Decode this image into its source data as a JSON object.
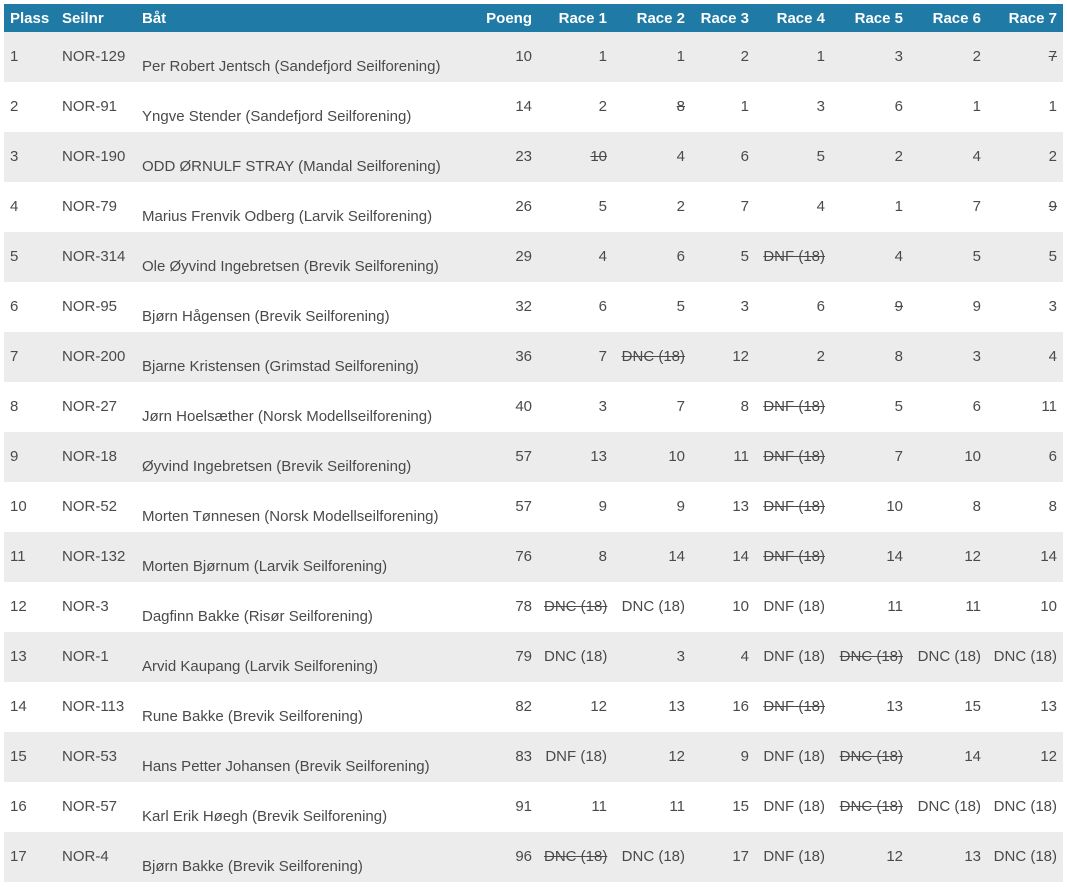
{
  "table": {
    "headers": {
      "plass": "Plass",
      "seilnr": "Seilnr",
      "bat": "Båt",
      "poeng": "Poeng",
      "races": [
        "Race 1",
        "Race 2",
        "Race 3",
        "Race 4",
        "Race 5",
        "Race 6",
        "Race 7"
      ]
    },
    "rows": [
      {
        "plass": "1",
        "seilnr": "NOR-129",
        "bat": "Per Robert Jentsch (Sandefjord Seilforening)",
        "poeng": "10",
        "races": [
          {
            "v": "1",
            "d": false
          },
          {
            "v": "1",
            "d": false
          },
          {
            "v": "2",
            "d": false
          },
          {
            "v": "1",
            "d": false
          },
          {
            "v": "3",
            "d": false
          },
          {
            "v": "2",
            "d": false
          },
          {
            "v": "7",
            "d": true
          }
        ]
      },
      {
        "plass": "2",
        "seilnr": "NOR-91",
        "bat": "Yngve Stender (Sandefjord Seilforening)",
        "poeng": "14",
        "races": [
          {
            "v": "2",
            "d": false
          },
          {
            "v": "8",
            "d": true
          },
          {
            "v": "1",
            "d": false
          },
          {
            "v": "3",
            "d": false
          },
          {
            "v": "6",
            "d": false
          },
          {
            "v": "1",
            "d": false
          },
          {
            "v": "1",
            "d": false
          }
        ]
      },
      {
        "plass": "3",
        "seilnr": "NOR-190",
        "bat": "ODD ØRNULF STRAY (Mandal Seilforening)",
        "poeng": "23",
        "races": [
          {
            "v": "10",
            "d": true
          },
          {
            "v": "4",
            "d": false
          },
          {
            "v": "6",
            "d": false
          },
          {
            "v": "5",
            "d": false
          },
          {
            "v": "2",
            "d": false
          },
          {
            "v": "4",
            "d": false
          },
          {
            "v": "2",
            "d": false
          }
        ]
      },
      {
        "plass": "4",
        "seilnr": "NOR-79",
        "bat": "Marius Frenvik Odberg (Larvik Seilforening)",
        "poeng": "26",
        "races": [
          {
            "v": "5",
            "d": false
          },
          {
            "v": "2",
            "d": false
          },
          {
            "v": "7",
            "d": false
          },
          {
            "v": "4",
            "d": false
          },
          {
            "v": "1",
            "d": false
          },
          {
            "v": "7",
            "d": false
          },
          {
            "v": "9",
            "d": true
          }
        ]
      },
      {
        "plass": "5",
        "seilnr": "NOR-314",
        "bat": "Ole Øyvind Ingebretsen (Brevik Seilforening)",
        "poeng": "29",
        "races": [
          {
            "v": "4",
            "d": false
          },
          {
            "v": "6",
            "d": false
          },
          {
            "v": "5",
            "d": false
          },
          {
            "v": "DNF (18)",
            "d": true
          },
          {
            "v": "4",
            "d": false
          },
          {
            "v": "5",
            "d": false
          },
          {
            "v": "5",
            "d": false
          }
        ]
      },
      {
        "plass": "6",
        "seilnr": "NOR-95",
        "bat": "Bjørn Hågensen (Brevik Seilforening)",
        "poeng": "32",
        "races": [
          {
            "v": "6",
            "d": false
          },
          {
            "v": "5",
            "d": false
          },
          {
            "v": "3",
            "d": false
          },
          {
            "v": "6",
            "d": false
          },
          {
            "v": "9",
            "d": true
          },
          {
            "v": "9",
            "d": false
          },
          {
            "v": "3",
            "d": false
          }
        ]
      },
      {
        "plass": "7",
        "seilnr": "NOR-200",
        "bat": "Bjarne Kristensen (Grimstad Seilforening)",
        "poeng": "36",
        "races": [
          {
            "v": "7",
            "d": false
          },
          {
            "v": "DNC (18)",
            "d": true
          },
          {
            "v": "12",
            "d": false
          },
          {
            "v": "2",
            "d": false
          },
          {
            "v": "8",
            "d": false
          },
          {
            "v": "3",
            "d": false
          },
          {
            "v": "4",
            "d": false
          }
        ]
      },
      {
        "plass": "8",
        "seilnr": "NOR-27",
        "bat": "Jørn Hoelsæther (Norsk Modellseilforening)",
        "poeng": "40",
        "races": [
          {
            "v": "3",
            "d": false
          },
          {
            "v": "7",
            "d": false
          },
          {
            "v": "8",
            "d": false
          },
          {
            "v": "DNF (18)",
            "d": true
          },
          {
            "v": "5",
            "d": false
          },
          {
            "v": "6",
            "d": false
          },
          {
            "v": "11",
            "d": false
          }
        ]
      },
      {
        "plass": "9",
        "seilnr": "NOR-18",
        "bat": "Øyvind Ingebretsen (Brevik Seilforening)",
        "poeng": "57",
        "races": [
          {
            "v": "13",
            "d": false
          },
          {
            "v": "10",
            "d": false
          },
          {
            "v": "11",
            "d": false
          },
          {
            "v": "DNF (18)",
            "d": true
          },
          {
            "v": "7",
            "d": false
          },
          {
            "v": "10",
            "d": false
          },
          {
            "v": "6",
            "d": false
          }
        ]
      },
      {
        "plass": "10",
        "seilnr": "NOR-52",
        "bat": "Morten Tønnesen (Norsk Modellseilforening)",
        "poeng": "57",
        "races": [
          {
            "v": "9",
            "d": false
          },
          {
            "v": "9",
            "d": false
          },
          {
            "v": "13",
            "d": false
          },
          {
            "v": "DNF (18)",
            "d": true
          },
          {
            "v": "10",
            "d": false
          },
          {
            "v": "8",
            "d": false
          },
          {
            "v": "8",
            "d": false
          }
        ]
      },
      {
        "plass": "11",
        "seilnr": "NOR-132",
        "bat": "Morten Bjørnum (Larvik Seilforening)",
        "poeng": "76",
        "races": [
          {
            "v": "8",
            "d": false
          },
          {
            "v": "14",
            "d": false
          },
          {
            "v": "14",
            "d": false
          },
          {
            "v": "DNF (18)",
            "d": true
          },
          {
            "v": "14",
            "d": false
          },
          {
            "v": "12",
            "d": false
          },
          {
            "v": "14",
            "d": false
          }
        ]
      },
      {
        "plass": "12",
        "seilnr": "NOR-3",
        "bat": "Dagfinn Bakke (Risør Seilforening)",
        "poeng": "78",
        "races": [
          {
            "v": "DNC (18)",
            "d": true
          },
          {
            "v": "DNC (18)",
            "d": false
          },
          {
            "v": "10",
            "d": false
          },
          {
            "v": "DNF (18)",
            "d": false
          },
          {
            "v": "11",
            "d": false
          },
          {
            "v": "11",
            "d": false
          },
          {
            "v": "10",
            "d": false
          }
        ]
      },
      {
        "plass": "13",
        "seilnr": "NOR-1",
        "bat": "Arvid Kaupang (Larvik Seilforening)",
        "poeng": "79",
        "races": [
          {
            "v": "DNC (18)",
            "d": false
          },
          {
            "v": "3",
            "d": false
          },
          {
            "v": "4",
            "d": false
          },
          {
            "v": "DNF (18)",
            "d": false
          },
          {
            "v": "DNC (18)",
            "d": true
          },
          {
            "v": "DNC (18)",
            "d": false
          },
          {
            "v": "DNC (18)",
            "d": false
          }
        ]
      },
      {
        "plass": "14",
        "seilnr": "NOR-113",
        "bat": "Rune Bakke (Brevik Seilforening)",
        "poeng": "82",
        "races": [
          {
            "v": "12",
            "d": false
          },
          {
            "v": "13",
            "d": false
          },
          {
            "v": "16",
            "d": false
          },
          {
            "v": "DNF (18)",
            "d": true
          },
          {
            "v": "13",
            "d": false
          },
          {
            "v": "15",
            "d": false
          },
          {
            "v": "13",
            "d": false
          }
        ]
      },
      {
        "plass": "15",
        "seilnr": "NOR-53",
        "bat": "Hans Petter Johansen (Brevik Seilforening)",
        "poeng": "83",
        "races": [
          {
            "v": "DNF (18)",
            "d": false
          },
          {
            "v": "12",
            "d": false
          },
          {
            "v": "9",
            "d": false
          },
          {
            "v": "DNF (18)",
            "d": false
          },
          {
            "v": "DNC (18)",
            "d": true
          },
          {
            "v": "14",
            "d": false
          },
          {
            "v": "12",
            "d": false
          }
        ]
      },
      {
        "plass": "16",
        "seilnr": "NOR-57",
        "bat": "Karl Erik Høegh (Brevik Seilforening)",
        "poeng": "91",
        "races": [
          {
            "v": "11",
            "d": false
          },
          {
            "v": "11",
            "d": false
          },
          {
            "v": "15",
            "d": false
          },
          {
            "v": "DNF (18)",
            "d": false
          },
          {
            "v": "DNC (18)",
            "d": true
          },
          {
            "v": "DNC (18)",
            "d": false
          },
          {
            "v": "DNC (18)",
            "d": false
          }
        ]
      },
      {
        "plass": "17",
        "seilnr": "NOR-4",
        "bat": "Bjørn Bakke (Brevik Seilforening)",
        "poeng": "96",
        "races": [
          {
            "v": "DNC (18)",
            "d": true
          },
          {
            "v": "DNC (18)",
            "d": false
          },
          {
            "v": "17",
            "d": false
          },
          {
            "v": "DNF (18)",
            "d": false
          },
          {
            "v": "12",
            "d": false
          },
          {
            "v": "13",
            "d": false
          },
          {
            "v": "DNC (18)",
            "d": false
          }
        ]
      }
    ]
  }
}
